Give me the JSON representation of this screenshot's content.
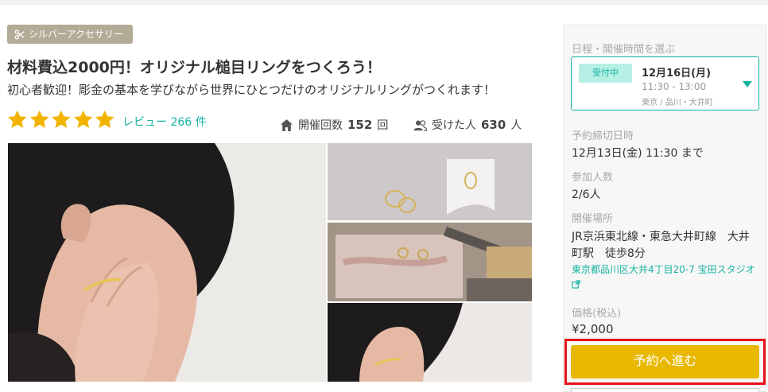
{
  "category": {
    "label": "シルバーアクセサリー",
    "icon": "scissors-icon"
  },
  "title": "材料費込2000円！オリジナル槌目リングをつくろう！",
  "subtitle": "初心者歓迎！彫金の基本を学びながら世界にひとつだけのオリジナルリングがつくれます！",
  "rating": {
    "stars": 5,
    "max": 5,
    "star_color": "#f3b400",
    "review_label": "レビュー 266 件"
  },
  "stats": {
    "held_label": "開催回数",
    "held_value": "152",
    "held_unit": "回",
    "joined_label": "受けた人",
    "joined_value": "630",
    "joined_unit": "人"
  },
  "photos": [
    {
      "name": "photo-main-ring-on-hand"
    },
    {
      "name": "photo-rings-on-paper"
    },
    {
      "name": "photo-workbench-tools"
    },
    {
      "name": "photo-ring-on-ear"
    }
  ],
  "panel": {
    "schedule_label": "日程・開催時間を選ぶ",
    "schedule": {
      "badge": "受付中",
      "date": "12月16日(月)",
      "time": "11:30 - 13:00",
      "location": "東京 / 品川・大井町"
    },
    "deadline_label": "予約締切日時",
    "deadline_value": "12月13日(金) 11:30 まで",
    "participants_label": "参加人数",
    "participants_value": "2/6人",
    "venue_label": "開催場所",
    "venue_line1": "JR京浜東北線・東急大井町線　大井",
    "venue_line2": "町駅　徒歩8分",
    "venue_address": "東京都品川区大井4丁目20-7 宝田スタジオ",
    "price_label": "価格(税込)",
    "price_value": "¥2,000",
    "reserve_button": "予約へ進む"
  },
  "colors": {
    "accent": "#16b3a0",
    "button": "#e8b800",
    "highlight": "#e8101a",
    "category_bg": "#b3ab96"
  }
}
